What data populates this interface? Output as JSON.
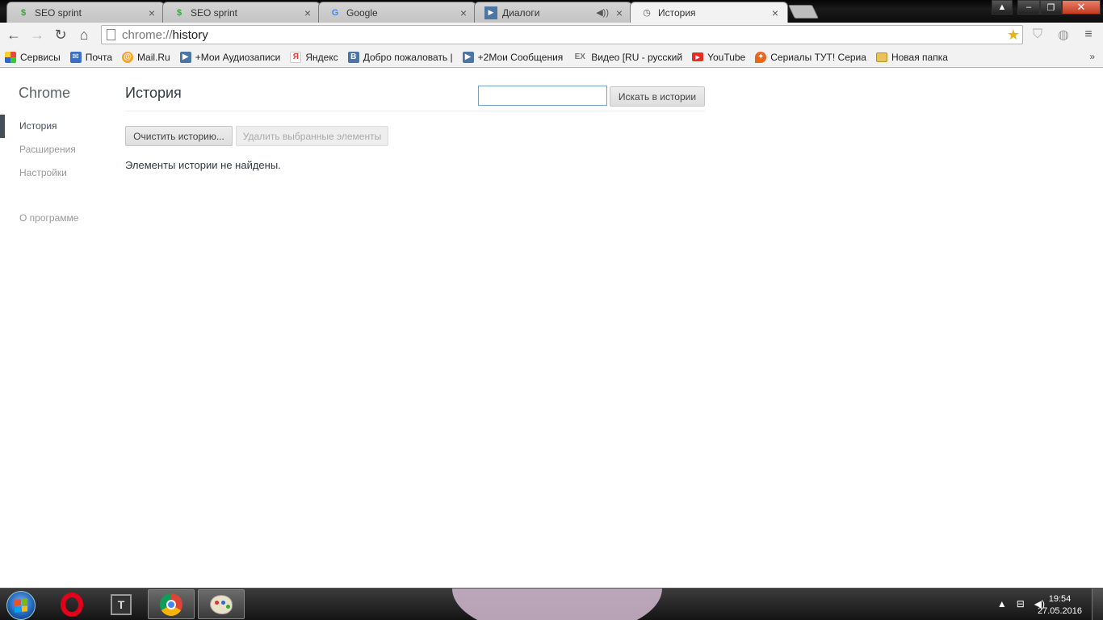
{
  "tabs": [
    {
      "title": "SEO sprint",
      "favicon": "seosprint-icon"
    },
    {
      "title": "SEO sprint",
      "favicon": "seosprint-icon"
    },
    {
      "title": "Google",
      "favicon": "google-icon"
    },
    {
      "title": "Диалоги",
      "favicon": "vk-video-icon"
    },
    {
      "title": "История",
      "favicon": "history-icon"
    }
  ],
  "omnibox": {
    "scheme": "chrome://",
    "path": "history"
  },
  "bookmarks": [
    {
      "label": "Сервисы",
      "icon": "apps-icon",
      "color": "#e44"
    },
    {
      "label": "Почта",
      "icon": "mail-icon",
      "color": "#3a6fc4"
    },
    {
      "label": "Mail.Ru",
      "icon": "mailru-icon",
      "color": "#f5a623"
    },
    {
      "label": "+Мои Аудиозаписи",
      "icon": "vk-play-icon",
      "color": "#4c75a3"
    },
    {
      "label": "Яндекс",
      "icon": "yandex-icon",
      "color": "#e33"
    },
    {
      "label": "Добро пожаловать |",
      "icon": "vk-icon",
      "color": "#4c75a3"
    },
    {
      "label": "+2Мои Сообщения",
      "icon": "vk-play-icon",
      "color": "#4c75a3"
    },
    {
      "label": "Видео [RU - русский",
      "icon": "ex-icon",
      "color": "#777"
    },
    {
      "label": "YouTube",
      "icon": "youtube-icon",
      "color": "#e52d27"
    },
    {
      "label": "Сериалы ТУТ! Сериа",
      "icon": "fox-icon",
      "color": "#e8671f"
    },
    {
      "label": "Новая папка",
      "icon": "folder-icon",
      "color": "#e8c25a"
    }
  ],
  "sidebar": {
    "title": "Chrome",
    "items": [
      {
        "label": "История",
        "selected": true
      },
      {
        "label": "Расширения",
        "selected": false
      },
      {
        "label": "Настройки",
        "selected": false
      }
    ],
    "about": "О программе"
  },
  "main": {
    "title": "История",
    "search_placeholder": "",
    "search_button": "Искать в истории",
    "clear_button": "Очистить историю...",
    "delete_button": "Удалить выбранные элементы",
    "empty_message": "Элементы истории не найдены."
  },
  "taskbar": {
    "time": "19:54",
    "date": "27.05.2016"
  }
}
